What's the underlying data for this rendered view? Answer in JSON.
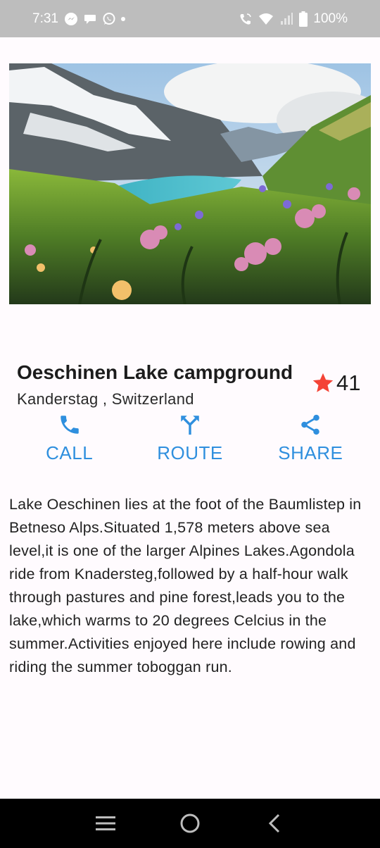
{
  "status_bar": {
    "time": "7:31",
    "battery": "100%",
    "left_icons": [
      "messenger-icon",
      "chat-bubble-icon",
      "whatsapp-icon",
      "notification-dot-icon"
    ],
    "right_icons": [
      "wifi-calling-icon",
      "wifi-icon",
      "signal-icon",
      "battery-icon"
    ]
  },
  "hero": {
    "image_icon": "lake-landscape-photo"
  },
  "place": {
    "title": "Oeschinen Lake campground",
    "location": "Kanderstag , Switzerland",
    "rating_count": "41",
    "rating_color": "#F44336"
  },
  "actions": [
    {
      "label": "CALL",
      "icon": "phone-icon"
    },
    {
      "label": "ROUTE",
      "icon": "route-icon"
    },
    {
      "label": "SHARE",
      "icon": "share-icon"
    }
  ],
  "accent_color": "#2F8FDE",
  "description": "Lake Oeschinen lies at the foot of the Baumlistep in Betneso Alps.Situated 1,578 meters above sea level,it is one of the larger Alpines Lakes.Agondola ride from Knadersteg,followed by a half-hour walk through pastures and pine forest,leads you to the lake,which warms to 20 degrees Celcius in the summer.Activities enjoyed here include rowing and riding the summer toboggan run.",
  "nav_bar": {
    "buttons": [
      "recent-apps-icon",
      "home-icon",
      "back-icon"
    ]
  }
}
